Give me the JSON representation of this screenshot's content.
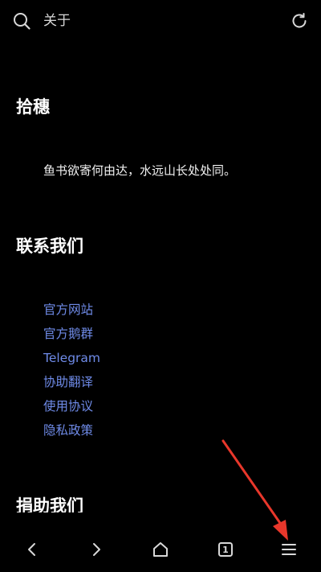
{
  "header": {
    "title": "关于",
    "search_icon": "search-icon",
    "refresh_icon": "refresh-icon"
  },
  "sections": {
    "shisui": {
      "heading": "拾穗",
      "text": "鱼书欲寄何由达，水远山长处处同。"
    },
    "contact": {
      "heading": "联系我们",
      "links": [
        "官方网站",
        "官方鹅群",
        "Telegram",
        "协助翻译",
        "使用协议",
        "隐私政策"
      ]
    },
    "donate": {
      "heading": "捐助我们"
    }
  },
  "bottom_nav": {
    "items": [
      "back-icon",
      "forward-icon",
      "home-icon",
      "tabs-icon",
      "menu-icon"
    ],
    "tab_count": "1"
  },
  "colors": {
    "background": "#000000",
    "link": "#6f8be8",
    "annotation": "#e8372b"
  }
}
